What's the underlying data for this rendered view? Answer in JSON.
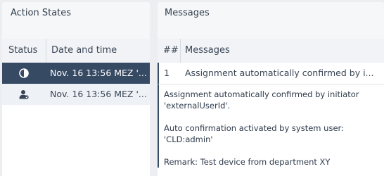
{
  "action_states": {
    "title": "Action States",
    "columns": {
      "status": "Status",
      "date": "Date and time"
    },
    "rows": [
      {
        "status_icon": "half-circle-icon",
        "date": "Nov. 16 13:56 MEZ '...",
        "selected": true
      },
      {
        "status_icon": "user-check-icon",
        "date": "Nov. 16 13:56 MEZ '...",
        "selected": false
      }
    ]
  },
  "messages": {
    "title": "Messages",
    "columns": {
      "num": "##",
      "message": "Messages"
    },
    "rows": [
      {
        "num": "1",
        "text": "Assignment automatically confirmed by i..."
      }
    ],
    "detail": {
      "line1": "Assignment automatically confirmed by initiator 'externalUserId'.",
      "line2": "Auto confirmation activated by system user: 'CLD:admin'",
      "line3": "Remark: Test device from department XY"
    }
  },
  "colors": {
    "selected_row": "#374a63",
    "panel_bg": "#f6f7f9",
    "app_bg": "#eceef1"
  }
}
